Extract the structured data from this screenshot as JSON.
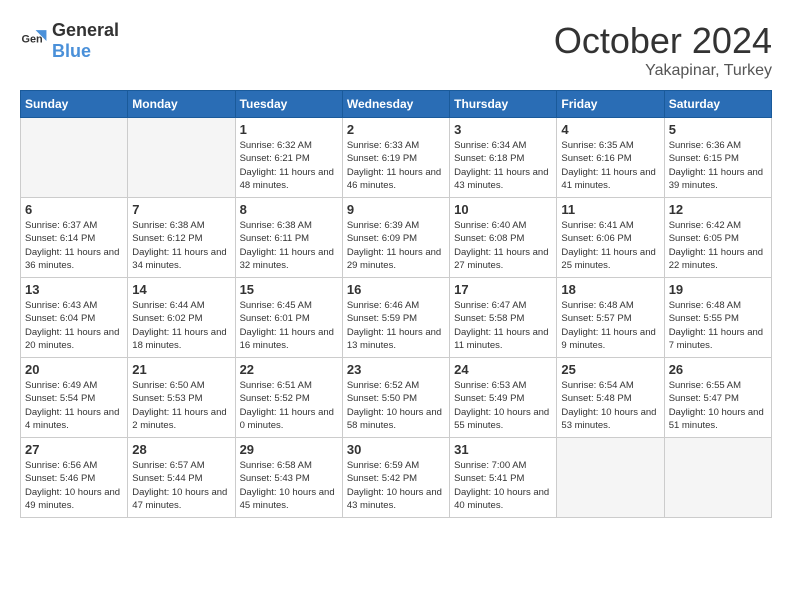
{
  "header": {
    "logo_general": "General",
    "logo_blue": "Blue",
    "month_year": "October 2024",
    "location": "Yakapinar, Turkey"
  },
  "days_of_week": [
    "Sunday",
    "Monday",
    "Tuesday",
    "Wednesday",
    "Thursday",
    "Friday",
    "Saturday"
  ],
  "weeks": [
    [
      {
        "day": "",
        "info": ""
      },
      {
        "day": "",
        "info": ""
      },
      {
        "day": "1",
        "info": "Sunrise: 6:32 AM\nSunset: 6:21 PM\nDaylight: 11 hours and 48 minutes."
      },
      {
        "day": "2",
        "info": "Sunrise: 6:33 AM\nSunset: 6:19 PM\nDaylight: 11 hours and 46 minutes."
      },
      {
        "day": "3",
        "info": "Sunrise: 6:34 AM\nSunset: 6:18 PM\nDaylight: 11 hours and 43 minutes."
      },
      {
        "day": "4",
        "info": "Sunrise: 6:35 AM\nSunset: 6:16 PM\nDaylight: 11 hours and 41 minutes."
      },
      {
        "day": "5",
        "info": "Sunrise: 6:36 AM\nSunset: 6:15 PM\nDaylight: 11 hours and 39 minutes."
      }
    ],
    [
      {
        "day": "6",
        "info": "Sunrise: 6:37 AM\nSunset: 6:14 PM\nDaylight: 11 hours and 36 minutes."
      },
      {
        "day": "7",
        "info": "Sunrise: 6:38 AM\nSunset: 6:12 PM\nDaylight: 11 hours and 34 minutes."
      },
      {
        "day": "8",
        "info": "Sunrise: 6:38 AM\nSunset: 6:11 PM\nDaylight: 11 hours and 32 minutes."
      },
      {
        "day": "9",
        "info": "Sunrise: 6:39 AM\nSunset: 6:09 PM\nDaylight: 11 hours and 29 minutes."
      },
      {
        "day": "10",
        "info": "Sunrise: 6:40 AM\nSunset: 6:08 PM\nDaylight: 11 hours and 27 minutes."
      },
      {
        "day": "11",
        "info": "Sunrise: 6:41 AM\nSunset: 6:06 PM\nDaylight: 11 hours and 25 minutes."
      },
      {
        "day": "12",
        "info": "Sunrise: 6:42 AM\nSunset: 6:05 PM\nDaylight: 11 hours and 22 minutes."
      }
    ],
    [
      {
        "day": "13",
        "info": "Sunrise: 6:43 AM\nSunset: 6:04 PM\nDaylight: 11 hours and 20 minutes."
      },
      {
        "day": "14",
        "info": "Sunrise: 6:44 AM\nSunset: 6:02 PM\nDaylight: 11 hours and 18 minutes."
      },
      {
        "day": "15",
        "info": "Sunrise: 6:45 AM\nSunset: 6:01 PM\nDaylight: 11 hours and 16 minutes."
      },
      {
        "day": "16",
        "info": "Sunrise: 6:46 AM\nSunset: 5:59 PM\nDaylight: 11 hours and 13 minutes."
      },
      {
        "day": "17",
        "info": "Sunrise: 6:47 AM\nSunset: 5:58 PM\nDaylight: 11 hours and 11 minutes."
      },
      {
        "day": "18",
        "info": "Sunrise: 6:48 AM\nSunset: 5:57 PM\nDaylight: 11 hours and 9 minutes."
      },
      {
        "day": "19",
        "info": "Sunrise: 6:48 AM\nSunset: 5:55 PM\nDaylight: 11 hours and 7 minutes."
      }
    ],
    [
      {
        "day": "20",
        "info": "Sunrise: 6:49 AM\nSunset: 5:54 PM\nDaylight: 11 hours and 4 minutes."
      },
      {
        "day": "21",
        "info": "Sunrise: 6:50 AM\nSunset: 5:53 PM\nDaylight: 11 hours and 2 minutes."
      },
      {
        "day": "22",
        "info": "Sunrise: 6:51 AM\nSunset: 5:52 PM\nDaylight: 11 hours and 0 minutes."
      },
      {
        "day": "23",
        "info": "Sunrise: 6:52 AM\nSunset: 5:50 PM\nDaylight: 10 hours and 58 minutes."
      },
      {
        "day": "24",
        "info": "Sunrise: 6:53 AM\nSunset: 5:49 PM\nDaylight: 10 hours and 55 minutes."
      },
      {
        "day": "25",
        "info": "Sunrise: 6:54 AM\nSunset: 5:48 PM\nDaylight: 10 hours and 53 minutes."
      },
      {
        "day": "26",
        "info": "Sunrise: 6:55 AM\nSunset: 5:47 PM\nDaylight: 10 hours and 51 minutes."
      }
    ],
    [
      {
        "day": "27",
        "info": "Sunrise: 6:56 AM\nSunset: 5:46 PM\nDaylight: 10 hours and 49 minutes."
      },
      {
        "day": "28",
        "info": "Sunrise: 6:57 AM\nSunset: 5:44 PM\nDaylight: 10 hours and 47 minutes."
      },
      {
        "day": "29",
        "info": "Sunrise: 6:58 AM\nSunset: 5:43 PM\nDaylight: 10 hours and 45 minutes."
      },
      {
        "day": "30",
        "info": "Sunrise: 6:59 AM\nSunset: 5:42 PM\nDaylight: 10 hours and 43 minutes."
      },
      {
        "day": "31",
        "info": "Sunrise: 7:00 AM\nSunset: 5:41 PM\nDaylight: 10 hours and 40 minutes."
      },
      {
        "day": "",
        "info": ""
      },
      {
        "day": "",
        "info": ""
      }
    ]
  ]
}
